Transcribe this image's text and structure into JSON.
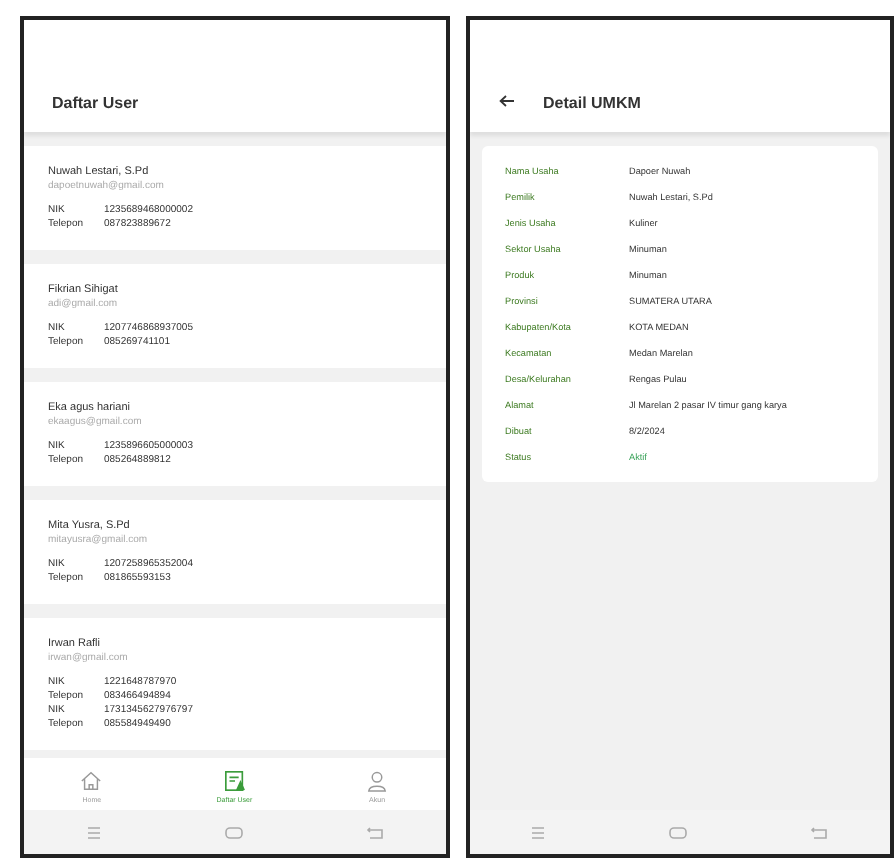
{
  "screens": [
    {
      "kind": "list",
      "title": "Daftar User",
      "users": [
        {
          "name": "Nuwah Lestari, S.Pd",
          "email": "dapoetnuwah@gmail.com",
          "fields": [
            {
              "label": "NIK",
              "value": "1235689468000002"
            },
            {
              "label": "Telepon",
              "value": "087823889672"
            }
          ]
        },
        {
          "name": "Fikrian Sihigat",
          "email": "adi@gmail.com",
          "fields": [
            {
              "label": "NIK",
              "value": "1207746868937005"
            },
            {
              "label": "Telepon",
              "value": "085269741101"
            }
          ]
        },
        {
          "name": "Eka agus hariani",
          "email": "ekaagus@gmail.com",
          "fields": [
            {
              "label": "NIK",
              "value": "1235896605000003"
            },
            {
              "label": "Telepon",
              "value": "085264889812"
            }
          ]
        },
        {
          "name": "Mita Yusra, S.Pd",
          "email": "mitayusra@gmail.com",
          "fields": [
            {
              "label": "NIK",
              "value": "1207258965352004"
            },
            {
              "label": "Telepon",
              "value": "081865593153"
            }
          ]
        },
        {
          "name": "Irwan Rafli",
          "email": "irwan@gmail.com",
          "fields": [
            {
              "label": "NIK",
              "value": "1221648787970"
            },
            {
              "label": "Telepon",
              "value": "083466494894"
            },
            {
              "label": "NIK",
              "value": "1731345627976797"
            },
            {
              "label": "Telepon",
              "value": "085584949490"
            }
          ]
        }
      ],
      "bottom_nav": [
        {
          "label": "Home",
          "kind": "home",
          "selected": false
        },
        {
          "label": "Daftar User",
          "kind": "list",
          "selected": true
        },
        {
          "label": "Akun",
          "kind": "user",
          "selected": false
        }
      ]
    },
    {
      "kind": "detail",
      "title": "Detail UMKM",
      "rows": [
        {
          "label": "Nama Usaha",
          "value": "Dapoer Nuwah"
        },
        {
          "label": "Pemilik",
          "value": "Nuwah Lestari, S.Pd"
        },
        {
          "label": "Jenis Usaha",
          "value": "Kuliner"
        },
        {
          "label": "Sektor Usaha",
          "value": "Minuman"
        },
        {
          "label": "Produk",
          "value": "Minuman"
        },
        {
          "label": "Provinsi",
          "value": "SUMATERA UTARA"
        },
        {
          "label": "Kabupaten/Kota",
          "value": "KOTA MEDAN"
        },
        {
          "label": "Kecamatan",
          "value": "Medan Marelan"
        },
        {
          "label": "Desa/Kelurahan",
          "value": "Rengas Pulau"
        },
        {
          "label": "Alamat",
          "value": "Jl Marelan 2 pasar IV timur gang karya"
        },
        {
          "label": "Dibuat",
          "value": "8/2/2024"
        },
        {
          "label": "Status",
          "value": "Aktif",
          "kind": "status"
        }
      ]
    }
  ]
}
